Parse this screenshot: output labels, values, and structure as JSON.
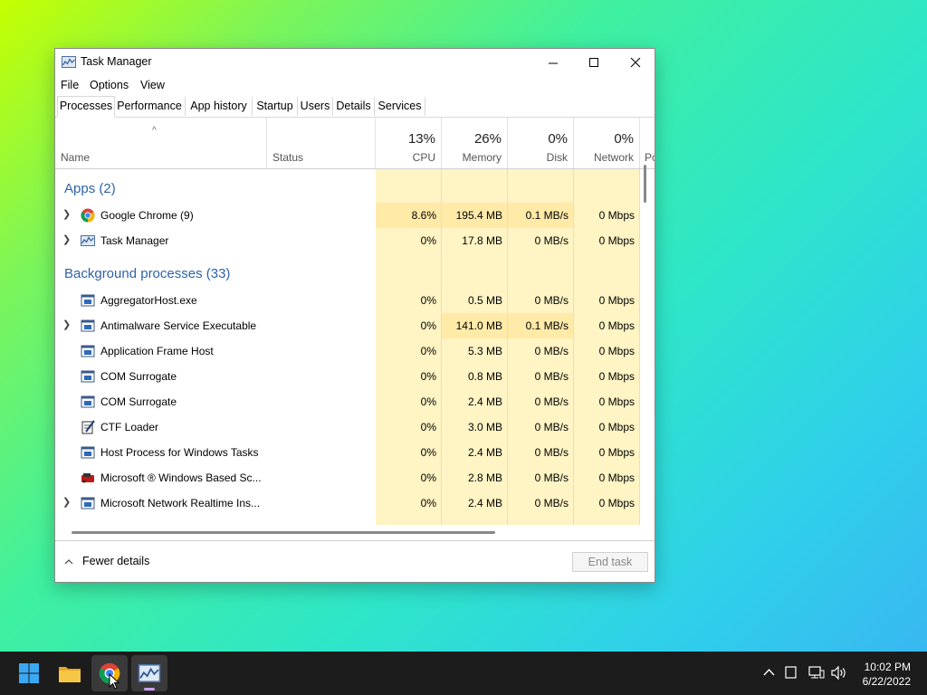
{
  "window": {
    "title": "Task Manager"
  },
  "menu": [
    "File",
    "Options",
    "View"
  ],
  "tabs": [
    "Processes",
    "Performance",
    "App history",
    "Startup",
    "Users",
    "Details",
    "Services"
  ],
  "columns": {
    "name": "Name",
    "status": "Status",
    "cpu": {
      "pct": "13%",
      "label": "CPU"
    },
    "memory": {
      "pct": "26%",
      "label": "Memory"
    },
    "disk": {
      "pct": "0%",
      "label": "Disk"
    },
    "network": {
      "pct": "0%",
      "label": "Network"
    },
    "power": "Po"
  },
  "groups": {
    "apps": "Apps (2)",
    "background": "Background processes (33)"
  },
  "apps": [
    {
      "name": "Google Chrome (9)",
      "cpu": "8.6%",
      "memory": "195.4 MB",
      "disk": "0.1 MB/s",
      "network": "0 Mbps",
      "icon": "chrome-icon",
      "expand": true
    },
    {
      "name": "Task Manager",
      "cpu": "0%",
      "memory": "17.8 MB",
      "disk": "0 MB/s",
      "network": "0 Mbps",
      "icon": "task-manager-icon",
      "expand": true
    }
  ],
  "background": [
    {
      "name": "AggregatorHost.exe",
      "cpu": "0%",
      "memory": "0.5 MB",
      "disk": "0 MB/s",
      "network": "0 Mbps",
      "icon": "process-icon",
      "expand": false
    },
    {
      "name": "Antimalware Service Executable",
      "cpu": "0%",
      "memory": "141.0 MB",
      "disk": "0.1 MB/s",
      "network": "0 Mbps",
      "icon": "process-icon",
      "expand": true
    },
    {
      "name": "Application Frame Host",
      "cpu": "0%",
      "memory": "5.3 MB",
      "disk": "0 MB/s",
      "network": "0 Mbps",
      "icon": "process-icon",
      "expand": false
    },
    {
      "name": "COM Surrogate",
      "cpu": "0%",
      "memory": "0.8 MB",
      "disk": "0 MB/s",
      "network": "0 Mbps",
      "icon": "process-icon",
      "expand": false
    },
    {
      "name": "COM Surrogate",
      "cpu": "0%",
      "memory": "2.4 MB",
      "disk": "0 MB/s",
      "network": "0 Mbps",
      "icon": "process-icon",
      "expand": false
    },
    {
      "name": "CTF Loader",
      "cpu": "0%",
      "memory": "3.0 MB",
      "disk": "0 MB/s",
      "network": "0 Mbps",
      "icon": "ctf-loader-icon",
      "expand": false
    },
    {
      "name": "Host Process for Windows Tasks",
      "cpu": "0%",
      "memory": "2.4 MB",
      "disk": "0 MB/s",
      "network": "0 Mbps",
      "icon": "process-icon",
      "expand": false
    },
    {
      "name": "Microsoft ® Windows Based Sc...",
      "cpu": "0%",
      "memory": "2.8 MB",
      "disk": "0 MB/s",
      "network": "0 Mbps",
      "icon": "script-host-icon",
      "expand": false
    },
    {
      "name": "Microsoft Network Realtime Ins...",
      "cpu": "0%",
      "memory": "2.4 MB",
      "disk": "0 MB/s",
      "network": "0 Mbps",
      "icon": "process-icon",
      "expand": true
    }
  ],
  "footer": {
    "fewer_details": "Fewer details",
    "end_task": "End task"
  },
  "taskbar": {
    "time": "10:02 PM",
    "date": "6/22/2022"
  }
}
